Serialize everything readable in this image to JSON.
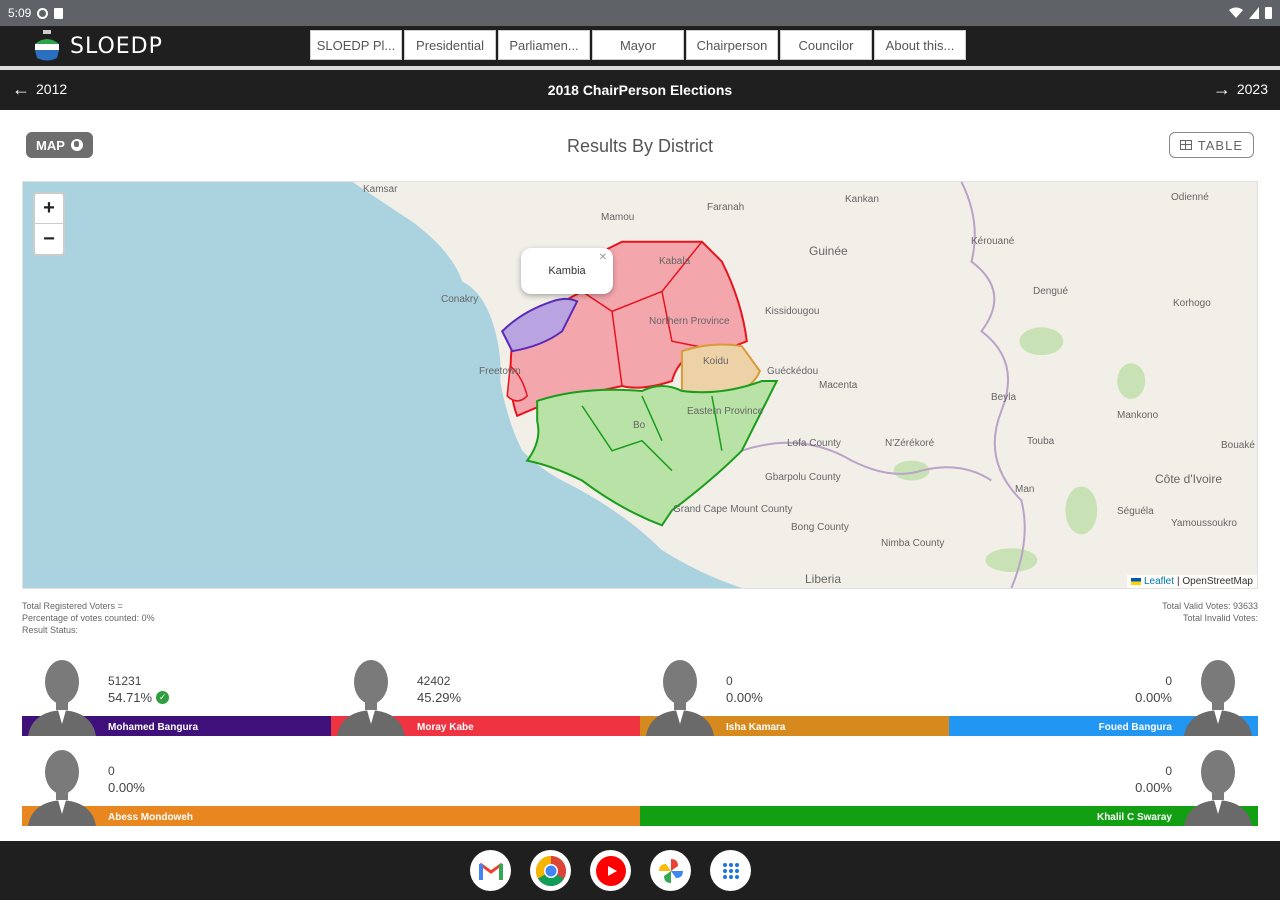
{
  "status_bar": {
    "time": "5:09"
  },
  "header": {
    "brand": "SLOEDP",
    "nav_tabs": [
      "SLOEDP Pl...",
      "Presidential",
      "Parliamen...",
      "Mayor",
      "Chairperson",
      "Councilor",
      "About this..."
    ]
  },
  "year_nav": {
    "prev_year": "2012",
    "title": "2018 ChairPerson Elections",
    "next_year": "2023"
  },
  "controls": {
    "map_label": "MAP",
    "results_title": "Results By District",
    "table_label": "TABLE"
  },
  "map": {
    "popup_text": "Kambia",
    "attribution_leaflet": "Leaflet",
    "attribution_osm": "| OpenStreetMap",
    "labels": [
      "Kamsar",
      "Conakry",
      "Freetown",
      "Kankan",
      "Guinée",
      "Korhogo",
      "Liberia",
      "Côte d'Ivoire",
      "Yamoussoukro",
      "Man",
      "N'Zérékoré",
      "Koidu",
      "Guéckédou",
      "Eastern Province",
      "Kissidougou",
      "Faranah",
      "Mamou",
      "Macenta",
      "Lofa County",
      "Gbarpolu County",
      "Bong County",
      "Nimba County",
      "Grand Cape Mount County",
      "Bo",
      "Kabala",
      "Northern Province",
      "Bouaké",
      "Séguéla",
      "Odienné",
      "Dengué",
      "Kérouané",
      "Beyla",
      "Touba",
      "Mankono"
    ]
  },
  "stats": {
    "registered": "Total Registered Voters =",
    "percent_counted": "Percentage of votes counted: 0%",
    "result_status": "Result Status:",
    "valid_votes": "Total Valid Votes: 93633",
    "invalid_votes": "Total Invalid Votes:"
  },
  "candidates_row1": [
    {
      "name": "Mohamed Bangura",
      "votes": "51231",
      "percent": "54.71%",
      "color": "#3f0f7a",
      "winner": true
    },
    {
      "name": "Moray Kabe",
      "votes": "42402",
      "percent": "45.29%",
      "color": "#ef3340"
    },
    {
      "name": "Isha Kamara",
      "votes": "0",
      "percent": "0.00%",
      "color": "#d68a1e"
    },
    {
      "name": "Foued Bangura",
      "votes": "0",
      "percent": "0.00%",
      "color": "#2196f3"
    }
  ],
  "candidates_row2": [
    {
      "name": "Abess Mondoweh",
      "votes": "0",
      "percent": "0.00%",
      "color": "#e8861f"
    },
    {
      "name": "Khalil C Swaray",
      "votes": "0",
      "percent": "0.00%",
      "color": "#12a012"
    }
  ],
  "dock": [
    "gmail-icon",
    "chrome-icon",
    "youtube-icon",
    "photos-icon",
    "apps-icon"
  ]
}
